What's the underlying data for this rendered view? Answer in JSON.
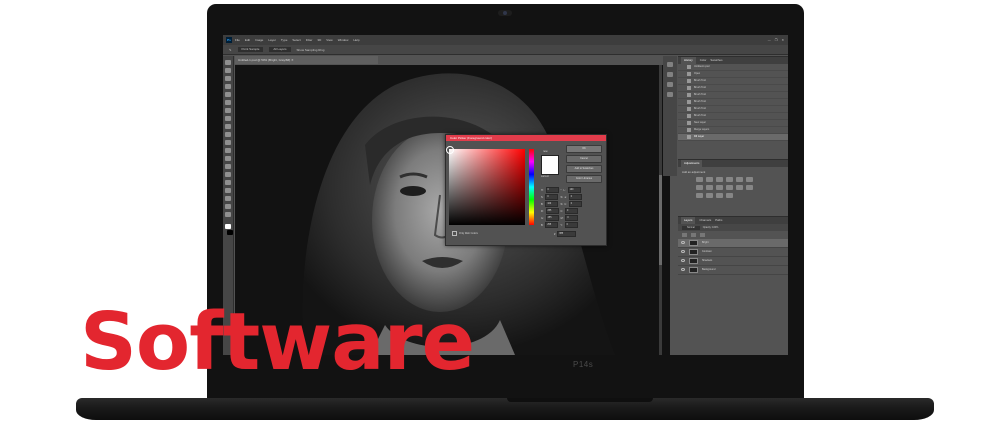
{
  "overlay": {
    "title": "Software"
  },
  "laptop": {
    "model_label": "P14s"
  },
  "photoshop": {
    "menu": [
      "File",
      "Edit",
      "Image",
      "Layer",
      "Type",
      "Select",
      "Filter",
      "3D",
      "View",
      "Window",
      "Help"
    ],
    "window_controls": [
      "—",
      "❐",
      "✕"
    ],
    "options": {
      "sample_size": "Point Sample",
      "sample": "All Layers",
      "show_ring": "Show Sampling Ring"
    },
    "document_tab": "Untitled-1.psd @ 50% (Bright, Gray/8#) ✕",
    "color_picker": {
      "title": "Color Picker (Foreground color)",
      "new_label": "new",
      "current_label": "current",
      "ok": "OK",
      "cancel": "Cancel",
      "add_to_swatches": "Add to Swatches",
      "color_libraries": "Color Libraries",
      "only_web_colors": "Only Web Colors",
      "fields": [
        {
          "label": "H:",
          "value": "0",
          "unit": "°",
          "label2": "L:",
          "value2": "100"
        },
        {
          "label": "S:",
          "value": "0",
          "unit": "%",
          "label2": "a:",
          "value2": "0"
        },
        {
          "label": "B:",
          "value": "100",
          "unit": "%",
          "label2": "b:",
          "value2": "0"
        },
        {
          "label": "R:",
          "value": "255",
          "unit": "",
          "label2": "C:",
          "value2": "0"
        },
        {
          "label": "G:",
          "value": "255",
          "unit": "",
          "label2": "M:",
          "value2": "0"
        },
        {
          "label": "B:",
          "value": "255",
          "unit": "",
          "label2": "Y:",
          "value2": "0"
        }
      ],
      "hex_label": "#",
      "hex_value": "ffffff"
    },
    "history": {
      "tabs": [
        "History",
        "Color",
        "Swatches"
      ],
      "items": [
        "Untitled-1.psd",
        "Open",
        "Brush Tool",
        "Brush Tool",
        "Brush Tool",
        "Brush Tool",
        "Brush Tool",
        "Brush Tool",
        "New Layer",
        "Merge Layers",
        "Fill Layer"
      ]
    },
    "adjustments": {
      "tab": "Adjustments",
      "label": "Add an adjustment"
    },
    "layers": {
      "tabs": [
        "Layers",
        "Channels",
        "Paths"
      ],
      "blend": "Normal",
      "opacity": "Opacity: 100%",
      "rows": [
        "Bright",
        "Contrast",
        "Shadows",
        "Background"
      ]
    }
  }
}
